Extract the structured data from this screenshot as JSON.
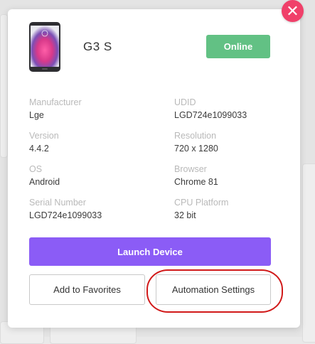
{
  "modal": {
    "close_glyph": "✕",
    "device": {
      "name": "G3 S",
      "status": "Online",
      "image_icon": "phone-icon"
    },
    "fields": [
      {
        "label": "Manufacturer",
        "value": "Lge"
      },
      {
        "label": "UDID",
        "value": "LGD724e1099033"
      },
      {
        "label": "Version",
        "value": "4.4.2"
      },
      {
        "label": "Resolution",
        "value": "720 x 1280"
      },
      {
        "label": "OS",
        "value": "Android"
      },
      {
        "label": "Browser",
        "value": "Chrome 81"
      },
      {
        "label": "Serial Number",
        "value": "LGD724e1099033"
      },
      {
        "label": "CPU Platform",
        "value": "32 bit"
      }
    ],
    "launch_label": "Launch Device",
    "favorites_label": "Add to Favorites",
    "automation_label": "Automation Settings"
  },
  "colors": {
    "accent_purple": "#8b5cf6",
    "status_green": "#62c184",
    "close_red": "#f0406a",
    "annotation_red": "#d11a1a"
  }
}
